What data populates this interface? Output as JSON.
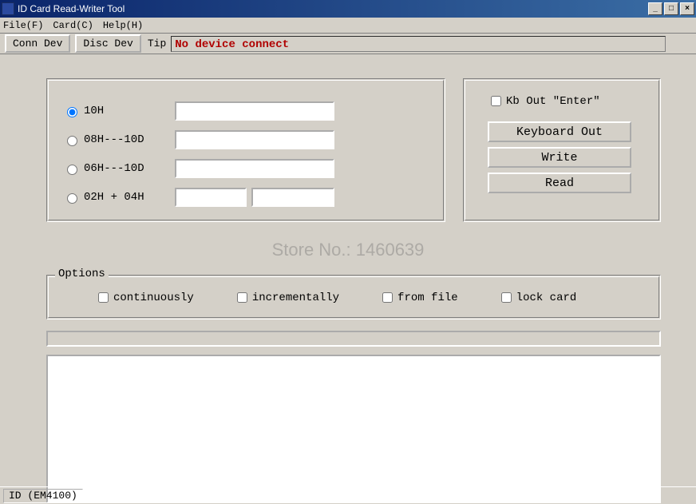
{
  "title": "ID Card Read-Writer Tool",
  "menu": {
    "file": "File(F)",
    "card": "Card(C)",
    "help": "Help(H)"
  },
  "toolbar": {
    "conn": "Conn Dev",
    "disc": "Disc Dev",
    "tip_label": "Tip",
    "tip_text": "No device connect"
  },
  "format": {
    "opt1": "10H",
    "opt2": "08H---10D",
    "opt3": "06H---10D",
    "opt4": "02H + 04H",
    "val1": "",
    "val2": "",
    "val3": "",
    "val4a": "",
    "val4b": ""
  },
  "right": {
    "kb_out_enter": "Kb Out \"Enter\"",
    "keyboard_out": "Keyboard Out",
    "write": "Write",
    "read": "Read"
  },
  "options": {
    "legend": "Options",
    "continuously": "continuously",
    "incrementally": "incrementally",
    "from_file": "from file",
    "lock_card": "lock card"
  },
  "status": {
    "tab": "ID (EM4100)"
  },
  "watermark": "Store No.: 1460639"
}
